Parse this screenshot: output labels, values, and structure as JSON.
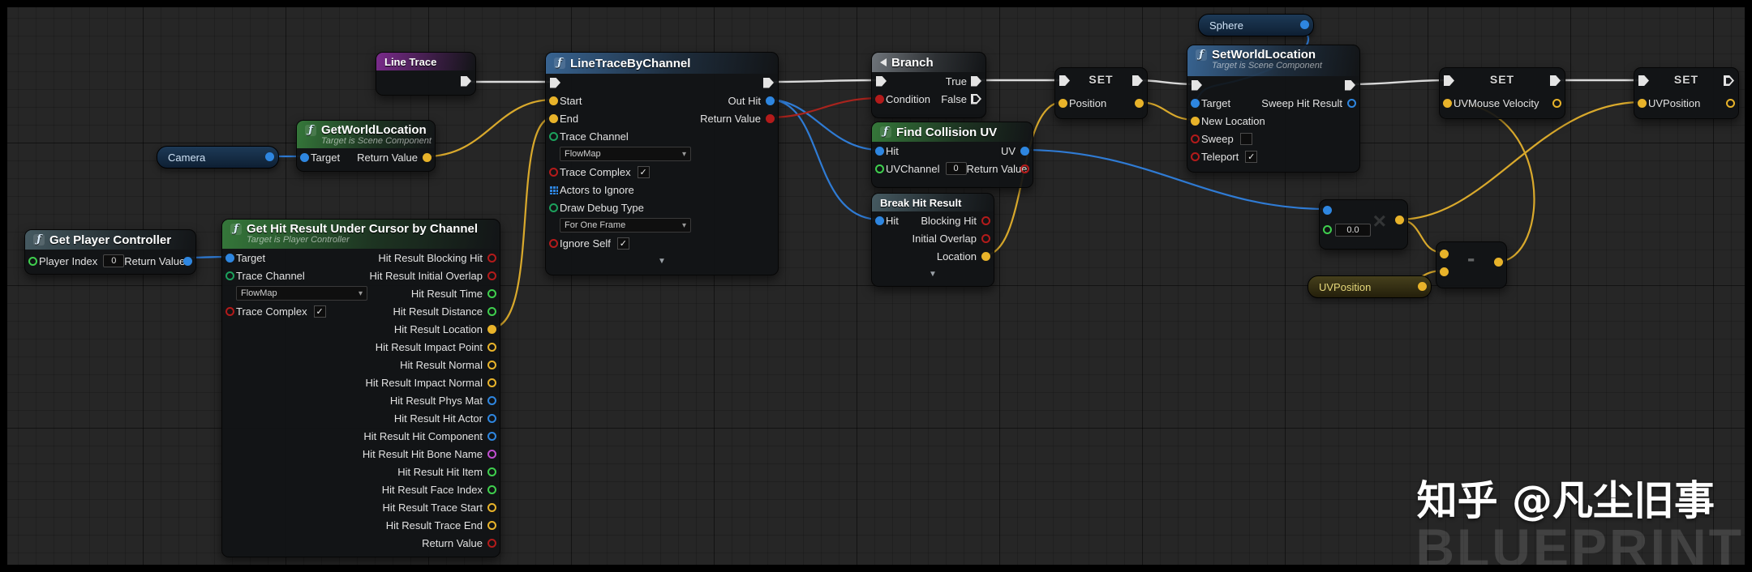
{
  "colors": {
    "exec_pin": "#e4e4e4",
    "vector_pin": "#e8b32a",
    "bool_pin": "#b31b1b",
    "object_pin": "#2e86e0",
    "int_pin": "#3fcf4e",
    "enum_pin": "#1ca05c",
    "name_pin": "#c14fd1",
    "wire_exec": "#dadada",
    "wire_vector": "#d9a92c",
    "wire_object": "#2f7bd4",
    "wire_bool": "#a8231d"
  },
  "watermark": {
    "author": "知乎 @凡尘旧事",
    "logo": "BLUEPRINT"
  },
  "nodes": {
    "line_trace": {
      "title": "Line Trace"
    },
    "camera_var": {
      "label": "Camera"
    },
    "sphere_var": {
      "label": "Sphere"
    },
    "uvposition_var": {
      "label": "UVPosition"
    },
    "get_world_location": {
      "fn_icon": "ƒ",
      "title": "GetWorldLocation",
      "subtitle": "Target is Scene Component",
      "target": "Target",
      "return_value": "Return Value"
    },
    "get_player_controller": {
      "fn_icon": "ƒ",
      "title": "Get Player Controller",
      "player_index": "Player Index",
      "player_index_value": "0",
      "return_value": "Return Value"
    },
    "get_hit_result": {
      "fn_icon": "ƒ",
      "title": "Get Hit Result Under Cursor by Channel",
      "subtitle": "Target is Player Controller",
      "target": "Target",
      "trace_channel": "Trace Channel",
      "trace_channel_value": "FlowMap",
      "trace_complex": "Trace Complex",
      "outputs": [
        "Hit Result Blocking Hit",
        "Hit Result Initial Overlap",
        "Hit Result Time",
        "Hit Result Distance",
        "Hit Result Location",
        "Hit Result Impact Point",
        "Hit Result Normal",
        "Hit Result Impact Normal",
        "Hit Result Phys Mat",
        "Hit Result Hit Actor",
        "Hit Result Hit Component",
        "Hit Result Hit Bone Name",
        "Hit Result Hit Item",
        "Hit Result Face Index",
        "Hit Result Trace Start",
        "Hit Result Trace End",
        "Return Value"
      ]
    },
    "line_trace_by_channel": {
      "fn_icon": "ƒ",
      "title": "LineTraceByChannel",
      "start": "Start",
      "end": "End",
      "trace_channel": "Trace Channel",
      "trace_channel_value": "FlowMap",
      "trace_complex": "Trace Complex",
      "actors_to_ignore": "Actors to Ignore",
      "draw_debug_type": "Draw Debug Type",
      "draw_debug_type_value": "For One Frame",
      "ignore_self": "Ignore Self",
      "out_hit": "Out Hit",
      "return_value": "Return Value"
    },
    "branch": {
      "title": "Branch",
      "condition": "Condition",
      "true_label": "True",
      "false_label": "False"
    },
    "find_collision_uv": {
      "fn_icon": "ƒ",
      "title": "Find Collision UV",
      "hit": "Hit",
      "uv_channel": "UVChannel",
      "uv_channel_value": "0",
      "uv": "UV",
      "return_value": "Return Value"
    },
    "break_hit_result": {
      "title": "Break Hit Result",
      "hit": "Hit",
      "blocking_hit": "Blocking Hit",
      "initial_overlap": "Initial Overlap",
      "location": "Location"
    },
    "set_position": {
      "title": "SET",
      "pin": "Position"
    },
    "set_world_location": {
      "fn_icon": "ƒ",
      "title": "SetWorldLocation",
      "subtitle": "Target is Scene Component",
      "target": "Target",
      "new_location": "New Location",
      "sweep": "Sweep",
      "teleport": "Teleport",
      "sweep_hit_result": "Sweep Hit Result"
    },
    "set_uvmouse_velocity": {
      "title": "SET",
      "pin": "UVMouse Velocity"
    },
    "set_uvposition": {
      "title": "SET",
      "pin": "UVPosition"
    },
    "multiply": {
      "value": "0.0",
      "symbol": "×"
    },
    "subtract": {
      "symbol": "-"
    }
  }
}
